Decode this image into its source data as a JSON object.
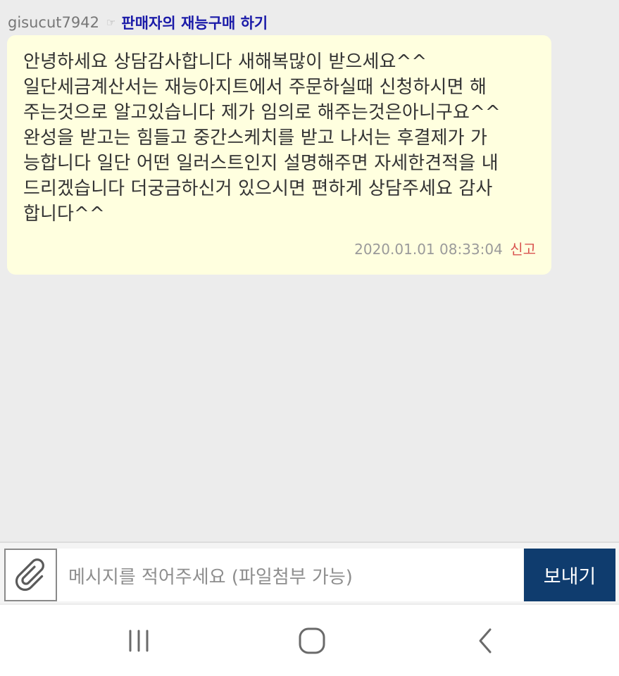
{
  "message": {
    "sender": "gisucut7942",
    "pointer_glyph": "☞",
    "product_link": "판매자의 재능구매 하기",
    "body": "안녕하세요 상담감사합니다 새해복많이 받으세요^^\n일단세금계산서는 재능아지트에서 주문하실때 신청하시면 해\n주는것으로 알고있습니다 제가 임의로 해주는것은아니구요^^\n완성을 받고는 힘들고 중간스케치를 받고 나서는 후결제가 가\n능합니다 일단 어떤 일러스트인지 설명해주면 자세한견적을 내\n드리겠습니다 더궁금하신거 있으시면 편하게 상담주세요 감사\n합니다^^",
    "timestamp": "2020.01.01 08:33:04",
    "report_label": "신고"
  },
  "compose": {
    "attach_icon": "paperclip-icon",
    "placeholder": "메시지를 적어주세요 (파일첨부 가능)",
    "value": "",
    "send_label": "보내기"
  },
  "navbar": {
    "icons": [
      "recent-apps-icon",
      "home-icon",
      "back-icon"
    ]
  },
  "colors": {
    "background": "#ececec",
    "bubble": "#ffffdf",
    "link": "#1a1aa8",
    "report": "#d9534f",
    "send_button": "#0f3c6e"
  }
}
